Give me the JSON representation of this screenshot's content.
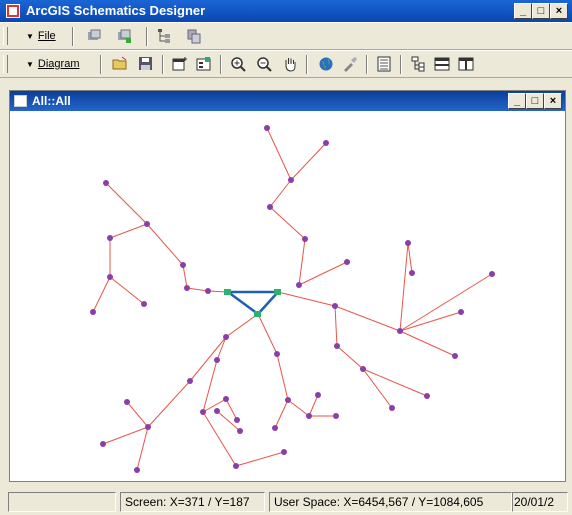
{
  "window": {
    "title": "ArcGIS Schematics Designer"
  },
  "toolbar1": {
    "file_label": "File"
  },
  "toolbar2": {
    "diagram_label": "Diagram"
  },
  "child_window": {
    "title": "All::All"
  },
  "statusbar": {
    "panel1": "",
    "screen": "Screen: X=371 / Y=187",
    "user_space": "User Space: X=6454,567 / Y=1084,605",
    "date": "20/01/2"
  },
  "colors": {
    "edge": "#e8554a",
    "node": "#8a3ea8",
    "selected_edge": "#1f5fb8",
    "selected_node": "#2fb070",
    "titlebar": "#0b46b0"
  },
  "icons": {
    "toolbar1": [
      "layer-icon",
      "layer-add-icon",
      "tree-icon",
      "copy-icon"
    ],
    "toolbar2": [
      "open-folder-icon",
      "save-icon",
      "new-window-icon",
      "properties-icon",
      "zoom-in-icon",
      "zoom-out-icon",
      "pan-hand-icon",
      "globe-icon",
      "tool-icon",
      "list-icon",
      "tree-view-icon",
      "horizontal-split-icon",
      "vertical-split-icon"
    ]
  }
}
